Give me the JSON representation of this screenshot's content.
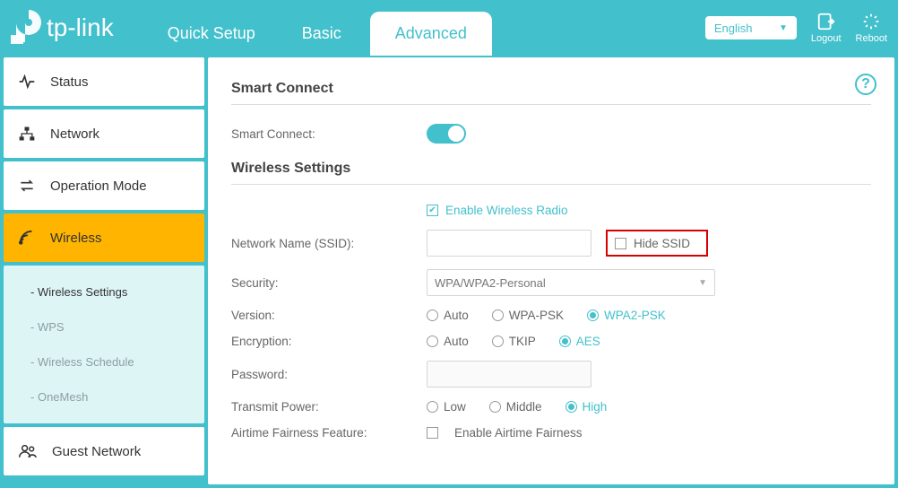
{
  "brand": "tp-link",
  "header": {
    "tabs": {
      "quick": "Quick Setup",
      "basic": "Basic",
      "advanced": "Advanced"
    },
    "language": "English",
    "logout": "Logout",
    "reboot": "Reboot"
  },
  "sidebar": {
    "status": "Status",
    "network": "Network",
    "operation_mode": "Operation Mode",
    "wireless": "Wireless",
    "guest_network": "Guest Network",
    "submenu": {
      "wireless_settings": "Wireless Settings",
      "wps": "WPS",
      "wireless_schedule": "Wireless Schedule",
      "onemesh": "OneMesh"
    }
  },
  "main": {
    "smart_connect_title": "Smart Connect",
    "smart_connect_label": "Smart Connect:",
    "wireless_settings_title": "Wireless Settings",
    "enable_wireless_radio": "Enable Wireless Radio",
    "ssid_label": "Network Name (SSID):",
    "ssid_value": "",
    "hide_ssid": "Hide SSID",
    "security_label": "Security:",
    "security_value": "WPA/WPA2-Personal",
    "version_label": "Version:",
    "version_opts": {
      "auto": "Auto",
      "wpa_psk": "WPA-PSK",
      "wpa2_psk": "WPA2-PSK"
    },
    "encryption_label": "Encryption:",
    "encryption_opts": {
      "auto": "Auto",
      "tkip": "TKIP",
      "aes": "AES"
    },
    "password_label": "Password:",
    "password_value": "",
    "transmit_label": "Transmit Power:",
    "transmit_opts": {
      "low": "Low",
      "middle": "Middle",
      "high": "High"
    },
    "airtime_label": "Airtime Fairness Feature:",
    "airtime_check": "Enable Airtime Fairness"
  }
}
